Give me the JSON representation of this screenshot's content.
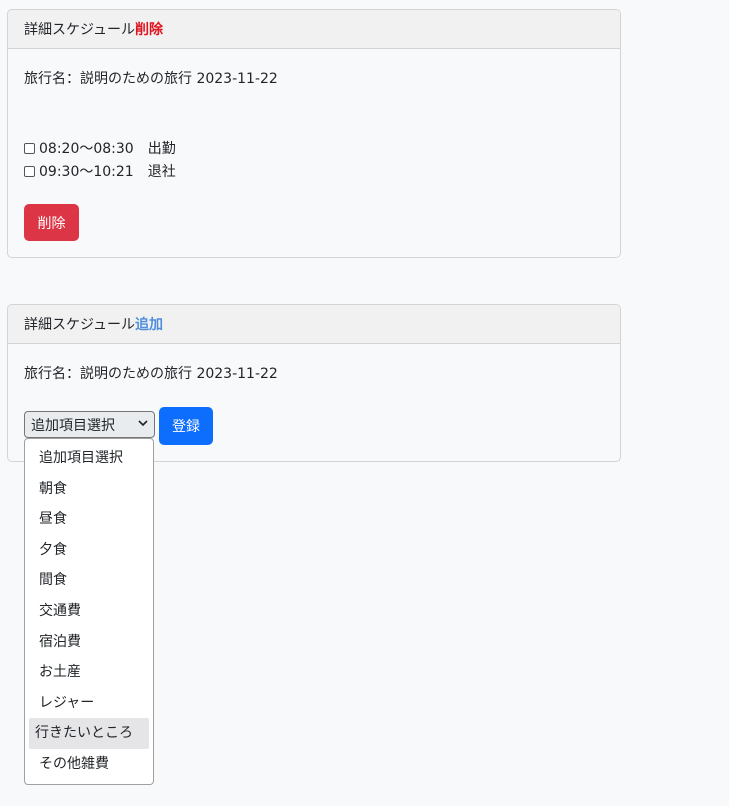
{
  "colors": {
    "danger": "#dc3545",
    "primary": "#0d6efd",
    "header_delete_accent": "#e0141e",
    "header_add_accent": "#4f8edc"
  },
  "delete_card": {
    "header_prefix": "詳細スケジュール",
    "header_accent": "削除",
    "trip_name": "旅行名：説明のための旅行 2023-11-22",
    "items": [
      {
        "label": "08:20〜08:30　出勤",
        "checked": false
      },
      {
        "label": "09:30〜10:21　退社",
        "checked": false
      }
    ],
    "delete_button": "削除"
  },
  "add_card": {
    "header_prefix": "詳細スケジュール",
    "header_accent": "追加",
    "trip_name": "旅行名：説明のための旅行 2023-11-22",
    "select_value": "追加項目選択",
    "register_button": "登録",
    "options": [
      "追加項目選択",
      "朝食",
      "昼食",
      "夕食",
      "間食",
      "交通費",
      "宿泊費",
      "お土産",
      "レジャー",
      "行きたいところ",
      "その他雑費"
    ],
    "hovered_option": "行きたいところ"
  }
}
